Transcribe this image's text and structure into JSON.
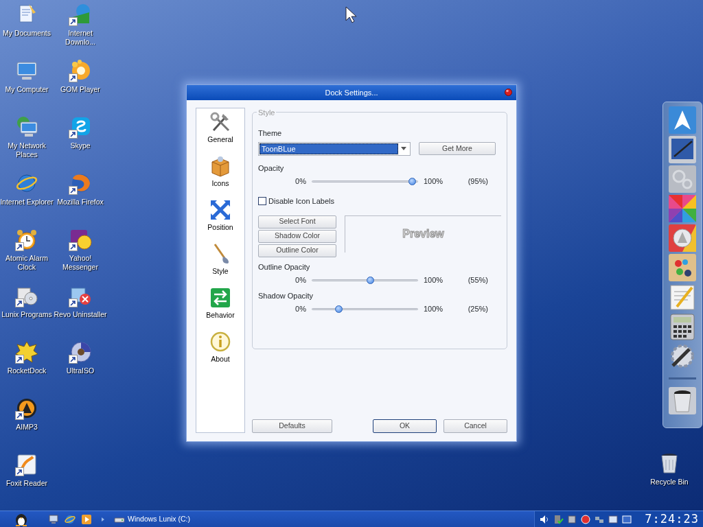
{
  "desktop_icons": [
    {
      "label": "My Documents",
      "shortcut": false
    },
    {
      "label": "My Computer",
      "shortcut": false
    },
    {
      "label": "My Network Places",
      "shortcut": false
    },
    {
      "label": "Internet Explorer",
      "shortcut": false
    },
    {
      "label": "Atomic Alarm Clock",
      "shortcut": true
    },
    {
      "label": "Lunix Programs",
      "shortcut": true
    },
    {
      "label": "RocketDock",
      "shortcut": true
    },
    {
      "label": "AIMP3",
      "shortcut": true
    },
    {
      "label": "Foxit Reader",
      "shortcut": true
    },
    {
      "label": "Internet Downlo...",
      "shortcut": true
    },
    {
      "label": "GOM Player",
      "shortcut": true
    },
    {
      "label": "Skype",
      "shortcut": true
    },
    {
      "label": "Mozilla Firefox",
      "shortcut": true
    },
    {
      "label": "Yahoo! Messenger",
      "shortcut": true
    },
    {
      "label": "Revo Uninstaller",
      "shortcut": true
    },
    {
      "label": "UltraISO",
      "shortcut": true
    }
  ],
  "recycle_bin": {
    "label": "Recycle Bin"
  },
  "dialog": {
    "title": "Dock Settings...",
    "sidebar": {
      "items": [
        {
          "label": "General"
        },
        {
          "label": "Icons"
        },
        {
          "label": "Position"
        },
        {
          "label": "Style"
        },
        {
          "label": "Behavior"
        },
        {
          "label": "About"
        }
      ]
    },
    "group": {
      "legend": "Style",
      "theme_label": "Theme",
      "theme_value": "ToonBLue",
      "get_more": "Get More",
      "sliders": [
        {
          "label": "Opacity",
          "min": "0%",
          "max": "100%",
          "reading": "(95%)",
          "level": 0.95
        },
        {
          "label": "Outline Opacity",
          "min": "0%",
          "max": "100%",
          "reading": "(55%)",
          "level": 0.55
        },
        {
          "label": "Shadow Opacity",
          "min": "0%",
          "max": "100%",
          "reading": "(25%)",
          "level": 0.25
        }
      ],
      "checkbox": {
        "label": "Disable Icon Labels",
        "checked": false
      },
      "font_buttons": [
        "Select Font",
        "Shadow Color",
        "Outline Color"
      ],
      "preview": "Preview"
    },
    "buttons": [
      {
        "label": "Defaults",
        "default": false
      },
      {
        "label": "OK",
        "default": true
      },
      {
        "label": "Cancel",
        "default": false
      }
    ]
  },
  "taskbar": {
    "task": "Windows Lunix (C:)",
    "clock": "7:24:23"
  }
}
